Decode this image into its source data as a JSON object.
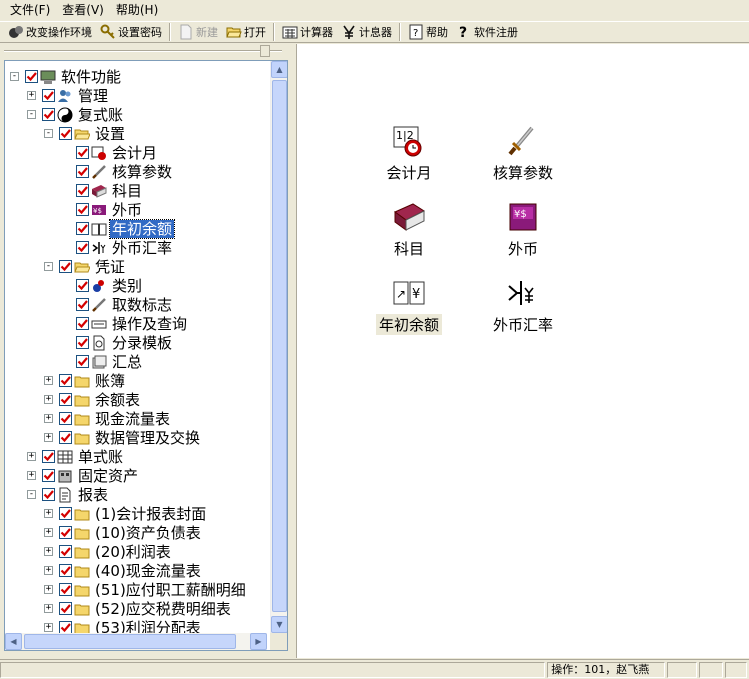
{
  "menu": [
    {
      "label": "文件(F)"
    },
    {
      "label": "查看(V)"
    },
    {
      "label": "帮助(H)"
    }
  ],
  "toolbar": {
    "change_env": "改变操作环境",
    "set_password": "设置密码",
    "new": "新建",
    "open": "打开",
    "calculator": "计算器",
    "counter": "计息器",
    "help": "帮助",
    "register": "软件注册"
  },
  "tree": {
    "root": "软件功能",
    "manage": "管理",
    "double_entry": "复式账",
    "settings": "设置",
    "accounting_month": "会计月",
    "accounting_params": "核算参数",
    "subjects": "科目",
    "foreign_currency": "外币",
    "opening_balance": "年初余额",
    "exchange_rate": "外币汇率",
    "voucher": "凭证",
    "category": "类别",
    "fetch_flag": "取数标志",
    "operate_query": "操作及查询",
    "entry_template": "分录模板",
    "summary": "汇总",
    "ledger": "账簿",
    "balance_sheet_table": "余额表",
    "cash_flow_table": "现金流量表",
    "data_manage": "数据管理及交换",
    "single_entry": "单式账",
    "fixed_assets": "固定资产",
    "reports": "报表",
    "report_items": [
      "(1)会计报表封面",
      "(10)资产负债表",
      "(20)利润表",
      "(40)现金流量表",
      "(51)应付职工薪酬明细",
      "(52)应交税费明细表",
      "(53)利润分配表"
    ]
  },
  "main": {
    "icons": [
      {
        "label": "会计月",
        "icon": "calendar-clock-icon"
      },
      {
        "label": "核算参数",
        "icon": "sword-icon"
      },
      {
        "label": "科目",
        "icon": "book-icon"
      },
      {
        "label": "外币",
        "icon": "currency-book-icon"
      },
      {
        "label": "年初余额",
        "icon": "open-book-yen-icon"
      },
      {
        "label": "外币汇率",
        "icon": "exchange-icon"
      }
    ]
  },
  "status": {
    "operator": "操作：101，赵飞燕"
  },
  "colors": {
    "selection": "#316ac5",
    "check": "#d40000",
    "folder": "#f5d66b",
    "window_bg": "#ece9d8"
  }
}
